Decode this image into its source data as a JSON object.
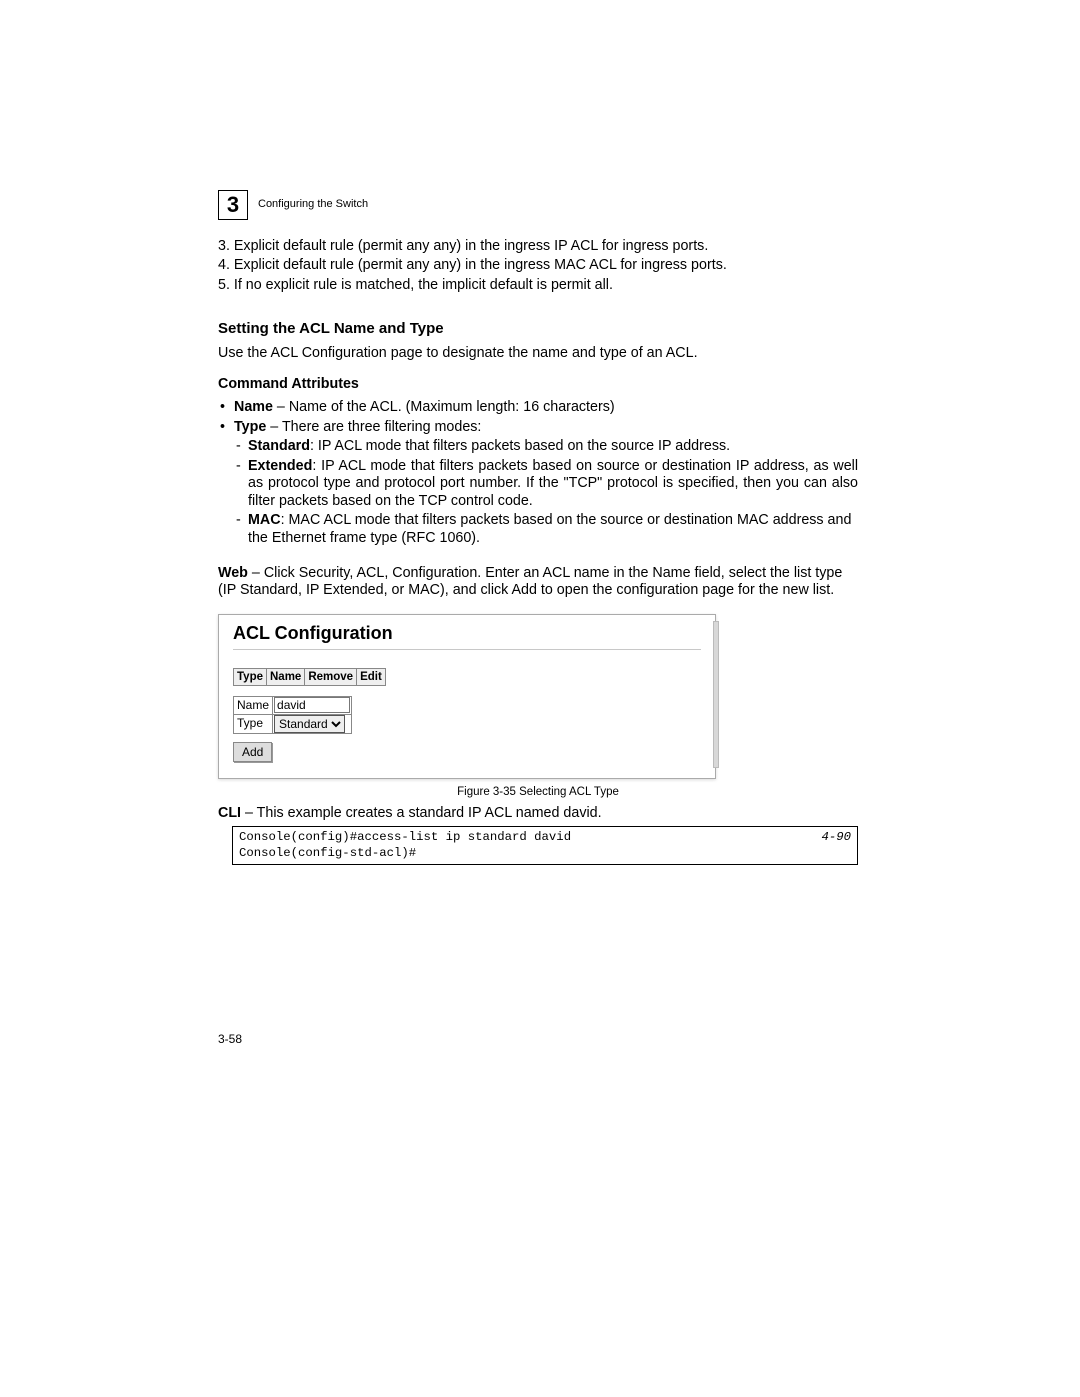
{
  "chapter": "3",
  "running_title": "Configuring the Switch",
  "rules": {
    "r3": "3. Explicit default rule (permit any any) in the ingress IP ACL for ingress ports.",
    "r4": "4. Explicit default rule (permit any any) in the ingress MAC ACL for ingress ports.",
    "r5": "5. If no explicit rule is matched, the implicit default is permit all."
  },
  "section_heading": "Setting the ACL Name and Type",
  "section_intro": "Use the ACL Configuration page to designate the name and type of an ACL.",
  "cmd_attr_heading": "Command Attributes",
  "attr_name_b": "Name",
  "attr_name_t": " – Name of the ACL. (Maximum length: 16 characters)",
  "attr_type_b": "Type",
  "attr_type_t": " – There are three filtering modes:",
  "mode_std_b": "Standard",
  "mode_std_t": ": IP ACL mode that filters packets based on the source IP address.",
  "mode_ext_b": "Extended",
  "mode_ext_t": ": IP ACL mode that filters packets based on source or destination IP address, as well as protocol type and protocol port number. If the \"TCP\" protocol is specified, then you can also filter packets based on the TCP control code.",
  "mode_mac_b": "MAC",
  "mode_mac_t": ": MAC ACL mode that filters packets based on the source or destination MAC address and the Ethernet frame type (RFC 1060).",
  "web_b": "Web",
  "web_t": " – Click Security, ACL, Configuration. Enter an ACL name in the Name field, select the list type (IP Standard, IP Extended, or MAC), and click Add to open the configuration page for the new list.",
  "ss": {
    "title": "ACL Configuration",
    "headers": [
      "Type",
      "Name",
      "Remove",
      "Edit"
    ],
    "row_name_label": "Name",
    "row_name_value": "david",
    "row_type_label": "Type",
    "row_type_value": "Standard",
    "add": "Add"
  },
  "figure": "Figure 3-35  Selecting ACL Type",
  "cli_b": "CLI",
  "cli_t": " – This example creates a standard IP ACL named david.",
  "code_line1": "Console(config)#access-list ip standard david",
  "code_ref": "4-90",
  "code_line2": "Console(config-std-acl)#",
  "page_num": "3-58"
}
